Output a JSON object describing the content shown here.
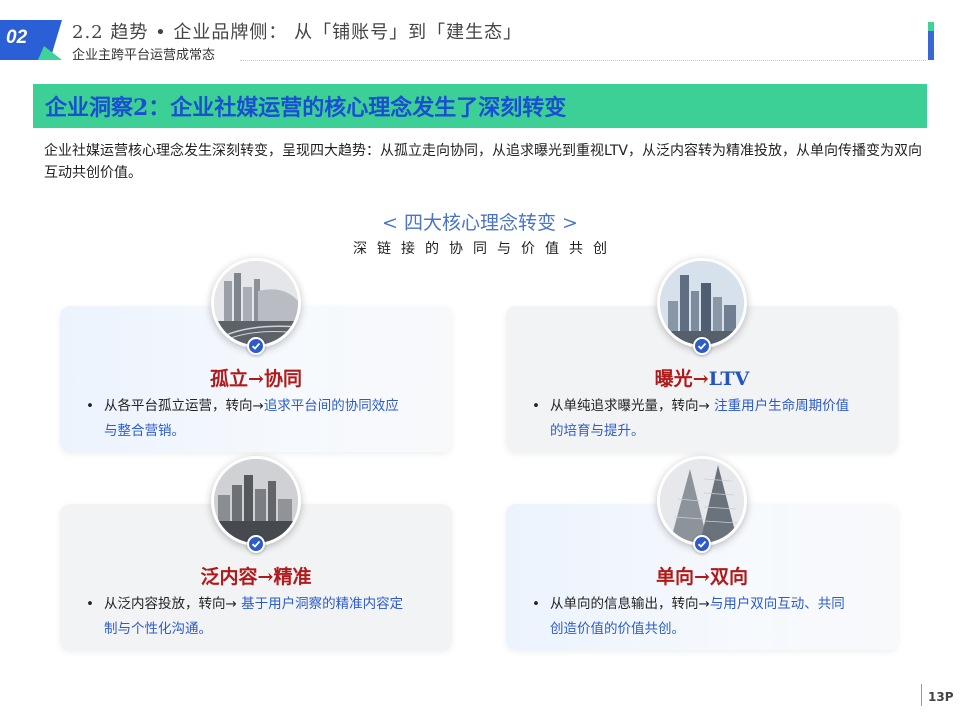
{
  "header": {
    "section_number": "02",
    "title": "2.2 趋势 • 企业品牌侧： 从「铺账号」到「建生态」",
    "subtitle": "企业主跨平台运营成常态"
  },
  "banner": {
    "title": "企业洞察2：企业社媒运营的核心理念发生了深刻转变"
  },
  "intro": "企业社媒运营核心理念发生深刻转变，呈现四大趋势：从孤立走向协同，从追求曝光到重视LTV，从泛内容转为精准投放，从单向传播变为双向互动共创价值。",
  "core": {
    "title": "< 四大核心理念转变 >",
    "subtitle": "深链接的协同与价值共创"
  },
  "cards": [
    {
      "title_from": "孤立",
      "title_arrow": "→",
      "title_to": "协同",
      "bullet": "•",
      "body_plain": "从各平台孤立运营，转向→",
      "body_highlight": "追求平台间的协同效应",
      "body_tail": "与整合营销。",
      "icon": "check-icon",
      "photo": "city-highway-photo"
    },
    {
      "title_from": "曝光",
      "title_arrow": "→",
      "title_to": "LTV",
      "bullet": "•",
      "body_plain": "从单纯追求曝光量，转向→ ",
      "body_highlight": "注重用户生命周期价值",
      "body_tail": "的培育与提升。",
      "icon": "check-icon",
      "photo": "city-towers-photo"
    },
    {
      "title_from": "泛内容",
      "title_arrow": "→",
      "title_to": "精准",
      "bullet": "•",
      "body_plain": "从泛内容投放，转向→ ",
      "body_highlight": "基于用户洞察的精准内容定",
      "body_tail": "制与个性化沟通。",
      "icon": "check-icon",
      "photo": "city-skyline-photo"
    },
    {
      "title_from": "单向",
      "title_arrow": "→",
      "title_to": "双向",
      "bullet": "•",
      "body_plain": "从单向的信息输出，转向→",
      "body_highlight": "与用户双向互动、共同",
      "body_tail": "创造价值的价值共创。",
      "icon": "check-icon",
      "photo": "skyscraper-photo"
    }
  ],
  "footer": {
    "page": "13P"
  },
  "colors": {
    "accent_green": "#3ccf96",
    "accent_blue": "#2d5cc9",
    "title_red": "#b01a1a"
  }
}
